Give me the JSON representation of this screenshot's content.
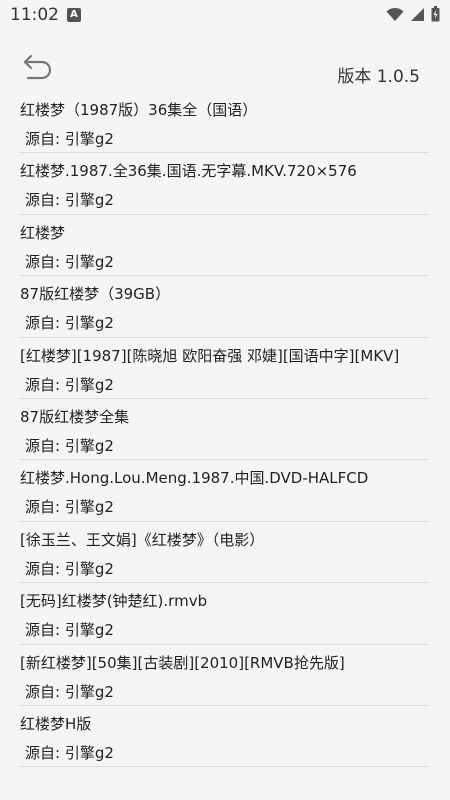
{
  "status_bar": {
    "time": "11:02",
    "notification_letter": "A"
  },
  "header": {
    "version": "版本 1.0.5"
  },
  "items": [
    {
      "title": "红楼梦（1987版）36集全（国语）",
      "source": "源自: 引擎g2"
    },
    {
      "title": "红楼梦.1987.全36集.国语.无字幕.MKV.720×576",
      "source": "源自: 引擎g2"
    },
    {
      "title": "红楼梦",
      "source": "源自: 引擎g2"
    },
    {
      "title": "87版红楼梦（39GB）",
      "source": "源自: 引擎g2"
    },
    {
      "title": "[红楼梦][1987][陈晓旭 欧阳奋强 邓婕][国语中字][MKV]",
      "source": "源自: 引擎g2"
    },
    {
      "title": "87版红楼梦全集",
      "source": "源自: 引擎g2"
    },
    {
      "title": "红楼梦.Hong.Lou.Meng.1987.中国.DVD-HALFCD",
      "source": "源自: 引擎g2"
    },
    {
      "title": "[徐玉兰、王文娟]《红楼梦》（电影）",
      "source": "源自: 引擎g2"
    },
    {
      "title": "[无码]红楼梦(钟楚红).rmvb",
      "source": "源自: 引擎g2"
    },
    {
      "title": "[新红楼梦][50集][古装剧][2010][RMVB抢先版]",
      "source": "源自: 引擎g2"
    },
    {
      "title": "红楼梦H版",
      "source": "源自: 引擎g2"
    }
  ]
}
